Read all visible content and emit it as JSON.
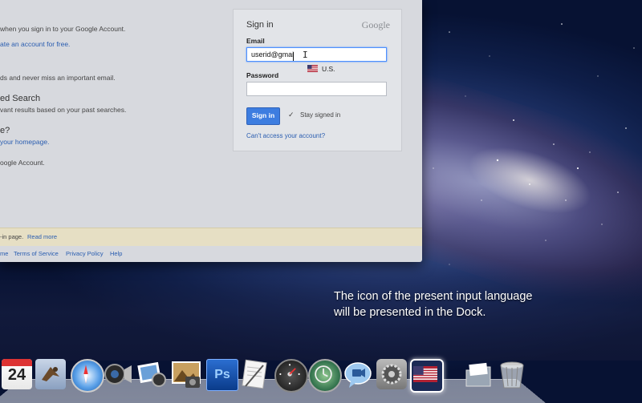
{
  "browser": {
    "left_texts": [
      "when you sign in to your Google Account.",
      "ate an account for free.",
      "ds and never miss an important email.",
      "ed Search",
      "vant results based on your past searches.",
      "e?",
      "your homepage.",
      "oogle Account."
    ],
    "banner": {
      "text": "-in page.",
      "link": "Read more"
    },
    "footer_links": [
      "me",
      "Terms of Service",
      "Privacy Policy",
      "Help"
    ]
  },
  "signin": {
    "title": "Sign in",
    "logo": "Google",
    "email_label": "Email",
    "email_value": "userid@gmai",
    "password_label": "Password",
    "password_value": "",
    "input_language": "U.S.",
    "button_label": "Sign in",
    "stay_signed_in": "Stay signed in",
    "stay_checked": true,
    "cant_access": "Can't access your account?"
  },
  "caption": {
    "line1": "The icon of the present input language",
    "line2": "will be presented in the Dock."
  },
  "dock": {
    "calendar_day": "24",
    "photoshop_label": "Ps",
    "icons": [
      "calendar-icon",
      "mail-icon",
      "safari-icon",
      "facetime-camera-icon",
      "iphoto-icon",
      "image-capture-icon",
      "photoshop-icon",
      "textedit-icon",
      "dashboard-icon",
      "time-machine-icon",
      "ichat-icon",
      "system-preferences-icon",
      "us-flag-input-icon",
      "documents-stack-icon",
      "trash-icon"
    ]
  },
  "colors": {
    "link": "#2a5db0",
    "button": "#3d7de0",
    "focus": "#4d90fe"
  }
}
